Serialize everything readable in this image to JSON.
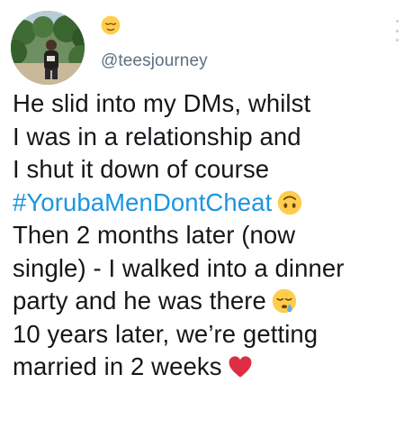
{
  "tweet": {
    "name_emoji": "relieved-face",
    "handle": "@teesjourney",
    "lines": [
      {
        "text": "He slid into my DMs, whilst"
      },
      {
        "text": "I was in a relationship and"
      },
      {
        "text": "I shut it down of course"
      },
      {
        "hashtag": "#YorubaMenDontCheat",
        "emoji": "upside-down-face"
      },
      {
        "text": "Then 2 months later (now"
      },
      {
        "text": "single) - I walked into a dinner"
      },
      {
        "text": "party and he was there",
        "emoji": "sleepy-face"
      },
      {
        "text": "10 years later, we’re getting"
      },
      {
        "text": "married in 2 weeks",
        "emoji": "red-heart"
      }
    ]
  },
  "colors": {
    "text": "#14171a",
    "handle": "#5b7083",
    "hashtag": "#1b95e0",
    "heart": "#dd2e44",
    "emoji_yellow": "#ffcc4d",
    "menu_dots": "#c4cfd6"
  }
}
